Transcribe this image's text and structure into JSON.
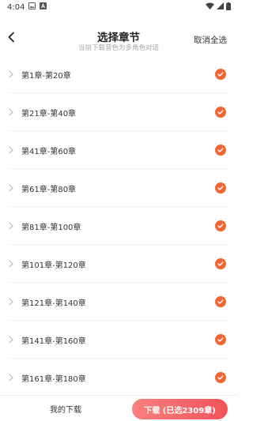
{
  "status_bar": {
    "time": "4:04"
  },
  "header": {
    "title": "选择章节",
    "subtitle": "当前下载音色为多角色对话",
    "cancel_all_label": "取消全选"
  },
  "chapters": [
    {
      "label": "第1章-第20章",
      "selected": true
    },
    {
      "label": "第21章-第40章",
      "selected": true
    },
    {
      "label": "第41章-第60章",
      "selected": true
    },
    {
      "label": "第61章-第80章",
      "selected": true
    },
    {
      "label": "第81章-第100章",
      "selected": true
    },
    {
      "label": "第101章-第120章",
      "selected": true
    },
    {
      "label": "第121章-第140章",
      "selected": true
    },
    {
      "label": "第141章-第160章",
      "selected": true
    },
    {
      "label": "第161章-第180章",
      "selected": true
    }
  ],
  "bottom_bar": {
    "my_downloads_label": "我的下载",
    "download_label": "下载 (已选2309章)"
  },
  "colors": {
    "accent": "#f4642e",
    "download_gradient_start": "#fa7f7f",
    "download_gradient_end": "#f2535a"
  }
}
